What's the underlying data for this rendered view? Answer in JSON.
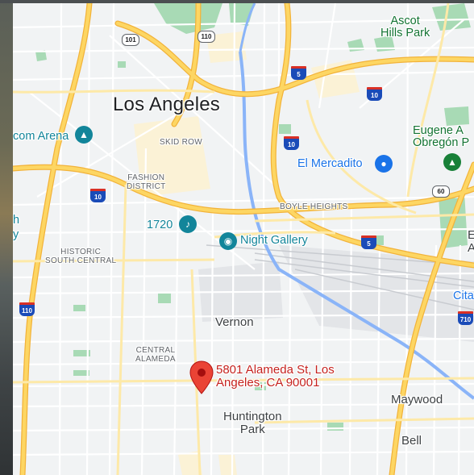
{
  "map": {
    "city_label": "Los Angeles",
    "places": {
      "ascot_line1": "Ascot",
      "ascot_line2": "Hills Park",
      "eugene_line1": "Eugene A",
      "eugene_line2": "Obregón P",
      "arena": "com Arena",
      "skid_row": "SKID ROW",
      "fashion_line1": "FASHION",
      "fashion_line2": "DISTRICT",
      "el_mercadito": "El Mercadito",
      "boyle_heights": "BOYLE HEIGHTS",
      "n1720": "1720",
      "night_gallery": "Night Gallery",
      "historic_line1": "HISTORIC",
      "historic_line2": "SOUTH CENTRAL",
      "vernon": "Vernon",
      "central_line1": "CENTRAL",
      "central_line2": "ALAMEDA",
      "maywood": "Maywood",
      "huntington_line1": "Huntington",
      "huntington_line2": "Park",
      "bell": "Bell",
      "cita": "Cita",
      "left_h": "h",
      "left_y": "y",
      "right_e": "E",
      "right_a": "A"
    },
    "marker": {
      "address_line1": "5801 Alameda St, Los",
      "address_line2": "Angeles, CA 90001"
    },
    "shields": {
      "us101": "101",
      "i110_top": "110",
      "i5_top": "5",
      "i10_right": "10",
      "i10_mid": "10",
      "i10_left": "10",
      "i5_mid": "5",
      "ca60": "60",
      "i110_bottom": "110",
      "i710": "710"
    },
    "colors": {
      "land": "#f1f3f4",
      "highway": "#fdd663",
      "highway_edge": "#f2b33a",
      "river": "#8ab4f8",
      "park": "#a8dab5",
      "marker": "#ea4335"
    }
  }
}
